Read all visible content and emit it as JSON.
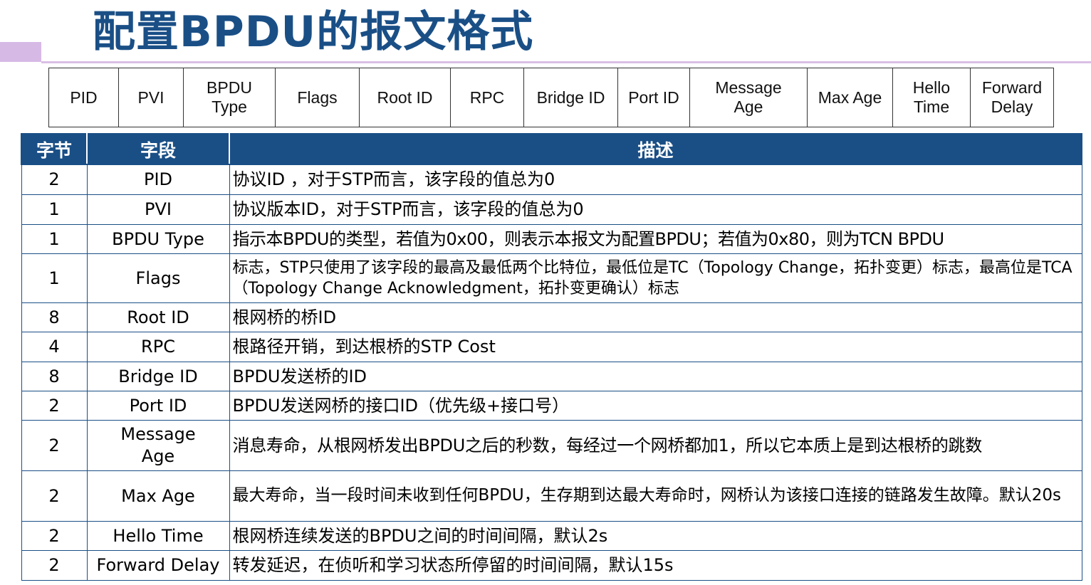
{
  "slide": {
    "title": "配置BPDU的报文格式"
  },
  "fields": [
    "PID",
    "PVI",
    "BPDU Type",
    "Flags",
    "Root ID",
    "RPC",
    "Bridge ID",
    "Port ID",
    "Message Age",
    "Max Age",
    "Hello Time",
    "Forward Delay"
  ],
  "table": {
    "headers": {
      "bytes": "字节",
      "field": "字段",
      "desc": "描述"
    },
    "rows": [
      {
        "bytes": "2",
        "field": "PID",
        "desc": "协议ID ，对于STP而言，该字段的值总为0"
      },
      {
        "bytes": "1",
        "field": "PVI",
        "desc": "协议版本ID，对于STP而言，该字段的值总为0"
      },
      {
        "bytes": "1",
        "field": "BPDU Type",
        "desc": "指示本BPDU的类型，若值为0x00，则表示本报文为配置BPDU；若值为0x80，则为TCN BPDU"
      },
      {
        "bytes": "1",
        "field": "Flags",
        "desc": "标志，STP只使用了该字段的最高及最低两个比特位，最低位是TC（Topology Change，拓扑变更）标志，最高位是TCA（Topology Change Acknowledgment，拓扑变更确认）标志"
      },
      {
        "bytes": "8",
        "field": "Root ID",
        "desc": "根网桥的桥ID"
      },
      {
        "bytes": "4",
        "field": "RPC",
        "desc": "根路径开销，到达根桥的STP Cost"
      },
      {
        "bytes": "8",
        "field": "Bridge ID",
        "desc": "BPDU发送桥的ID"
      },
      {
        "bytes": "2",
        "field": "Port ID",
        "desc": "BPDU发送网桥的接口ID（优先级+接口号）"
      },
      {
        "bytes": "2",
        "field": "Message Age",
        "desc": "消息寿命，从根网桥发出BPDU之后的秒数，每经过一个网桥都加1，所以它本质上是到达根桥的跳数"
      },
      {
        "bytes": "2",
        "field": "Max Age",
        "desc": "最大寿命，当一段时间未收到任何BPDU，生存期到达最大寿命时，网桥认为该接口连接的链路发生故障。默认20s"
      },
      {
        "bytes": "2",
        "field": "Hello Time",
        "desc": "根网桥连续发送的BPDU之间的时间间隔，默认2s"
      },
      {
        "bytes": "2",
        "field": "Forward Delay",
        "desc": "转发延迟，在侦听和学习状态所停留的时间间隔，默认15s"
      }
    ]
  },
  "colors": {
    "title": "#1a4f86",
    "header_bg": "#1a4f86",
    "accent": "#d7b9e6"
  }
}
